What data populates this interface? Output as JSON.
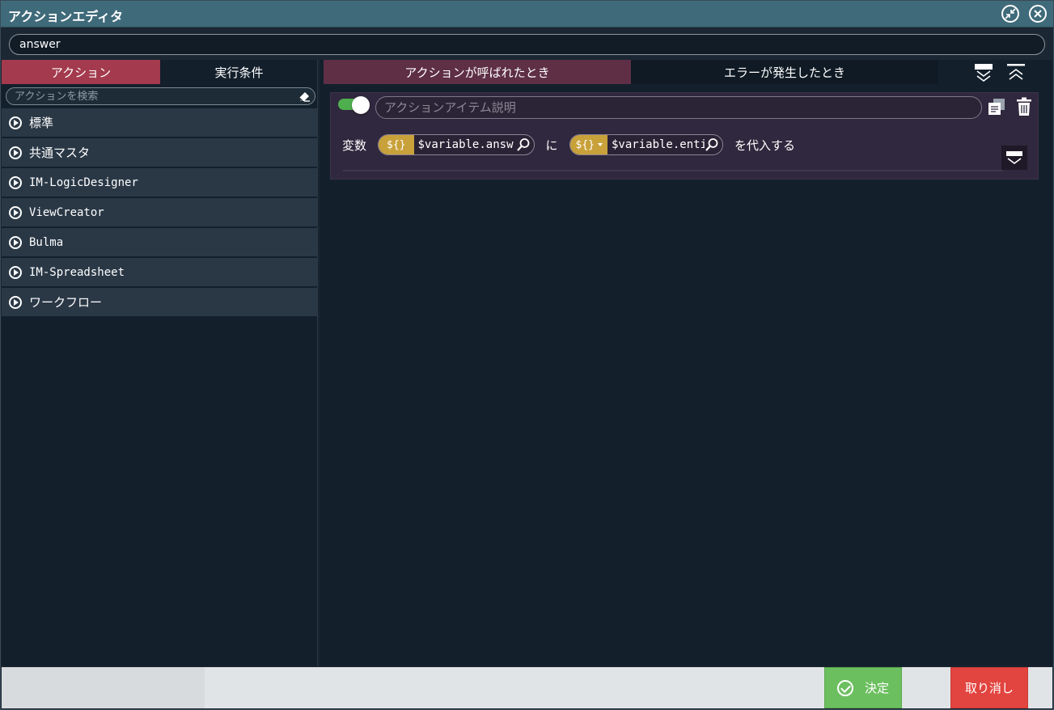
{
  "window": {
    "title": "アクションエディタ",
    "minimize_icon": "shrink-icon",
    "close_icon": "close-icon"
  },
  "action_name": {
    "value": "answer"
  },
  "left_tabs": [
    {
      "label": "アクション",
      "active": true
    },
    {
      "label": "実行条件",
      "active": false
    }
  ],
  "left_search": {
    "placeholder": "アクションを検索"
  },
  "categories": [
    {
      "label": "標準"
    },
    {
      "label": "共通マスタ"
    },
    {
      "label": "IM-LogicDesigner"
    },
    {
      "label": "ViewCreator"
    },
    {
      "label": "Bulma"
    },
    {
      "label": "IM-Spreadsheet"
    },
    {
      "label": "ワークフロー"
    }
  ],
  "right_tabs": [
    {
      "label": "アクションが呼ばれたとき",
      "active": true
    },
    {
      "label": "エラーが発生したとき",
      "active": false
    }
  ],
  "action_item": {
    "enabled": true,
    "description_placeholder": "アクションアイテム説明",
    "label_variable": "変数",
    "var_badge": "${}",
    "target_variable": "$variable.answ",
    "label_ni": "に",
    "source_badge": "${}",
    "source_variable": "$variable.enti",
    "label_assign": "を代入する"
  },
  "footer": {
    "ok_label": "決定",
    "cancel_label": "取り消し"
  },
  "colors": {
    "titlebar": "#3f6a7a",
    "active_tab_left": "#a33a4d",
    "active_tab_right": "#5e2f45",
    "toggle_on": "#4fae4e",
    "var_badge": "#c9a13a",
    "ok_button": "#6cbf5f",
    "cancel_button": "#e2443f"
  }
}
